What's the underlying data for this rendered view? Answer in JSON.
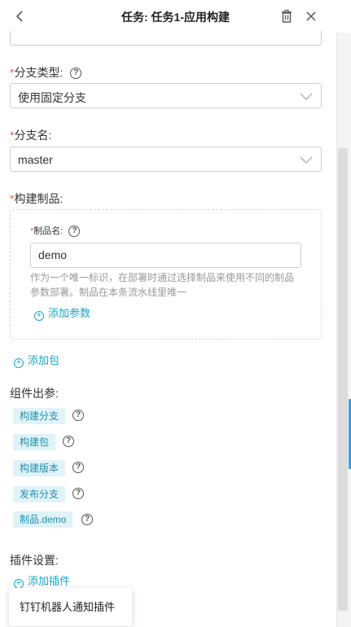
{
  "header": {
    "title": "任务: 任务1-应用构建"
  },
  "branch_type": {
    "label": "分支类型:",
    "value": "使用固定分支"
  },
  "branch_name": {
    "label": "分支名:",
    "value": "master"
  },
  "artifact": {
    "label": "构建制品:",
    "name_label": "制品名:",
    "name_value": "demo",
    "hint_line1": "作为一个唯一标识，在部署时通过选择制品来使用不同的制品",
    "hint_line2": "参数部署。制品在本条流水线里唯一",
    "add_param": "添加参数"
  },
  "add_package": "添加包",
  "outputs": {
    "label": "组件出参:",
    "tags": [
      "构建分支",
      "构建包",
      "构建版本",
      "发布分支",
      "制品.demo"
    ]
  },
  "plugins": {
    "label": "插件设置:",
    "add_plugin": "添加插件",
    "popup_item": "钉钉机器人通知插件"
  },
  "required_mark": "*",
  "colors": {
    "accent": "#1ba5c9",
    "required": "#e9683a",
    "tag_bg": "#dff3f8"
  }
}
